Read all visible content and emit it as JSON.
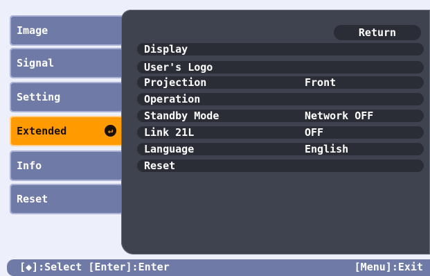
{
  "tabs": [
    {
      "label": "Image"
    },
    {
      "label": "Signal"
    },
    {
      "label": "Setting"
    },
    {
      "label": "Extended"
    },
    {
      "label": "Info"
    },
    {
      "label": "Reset"
    }
  ],
  "active_tab_icon": "enter-icon",
  "panel": {
    "return_label": "Return",
    "items": [
      {
        "label": "Display",
        "value": ""
      },
      {
        "label": "User's Logo",
        "value": ""
      },
      {
        "label": "Projection",
        "value": "Front"
      },
      {
        "label": "Operation",
        "value": ""
      },
      {
        "label": "Standby Mode",
        "value": "Network OFF"
      },
      {
        "label": "Link 21L",
        "value": "OFF"
      },
      {
        "label": "Language",
        "value": "English"
      },
      {
        "label": "Reset",
        "value": ""
      }
    ]
  },
  "footer": {
    "left": "[◆]:Select [Enter]:Enter",
    "right": "[Menu]:Exit"
  },
  "colors": {
    "background": "#edeffa",
    "tab": "#6f7aa6",
    "active_tab": "#ff9a00",
    "panel": "#3f4350"
  }
}
